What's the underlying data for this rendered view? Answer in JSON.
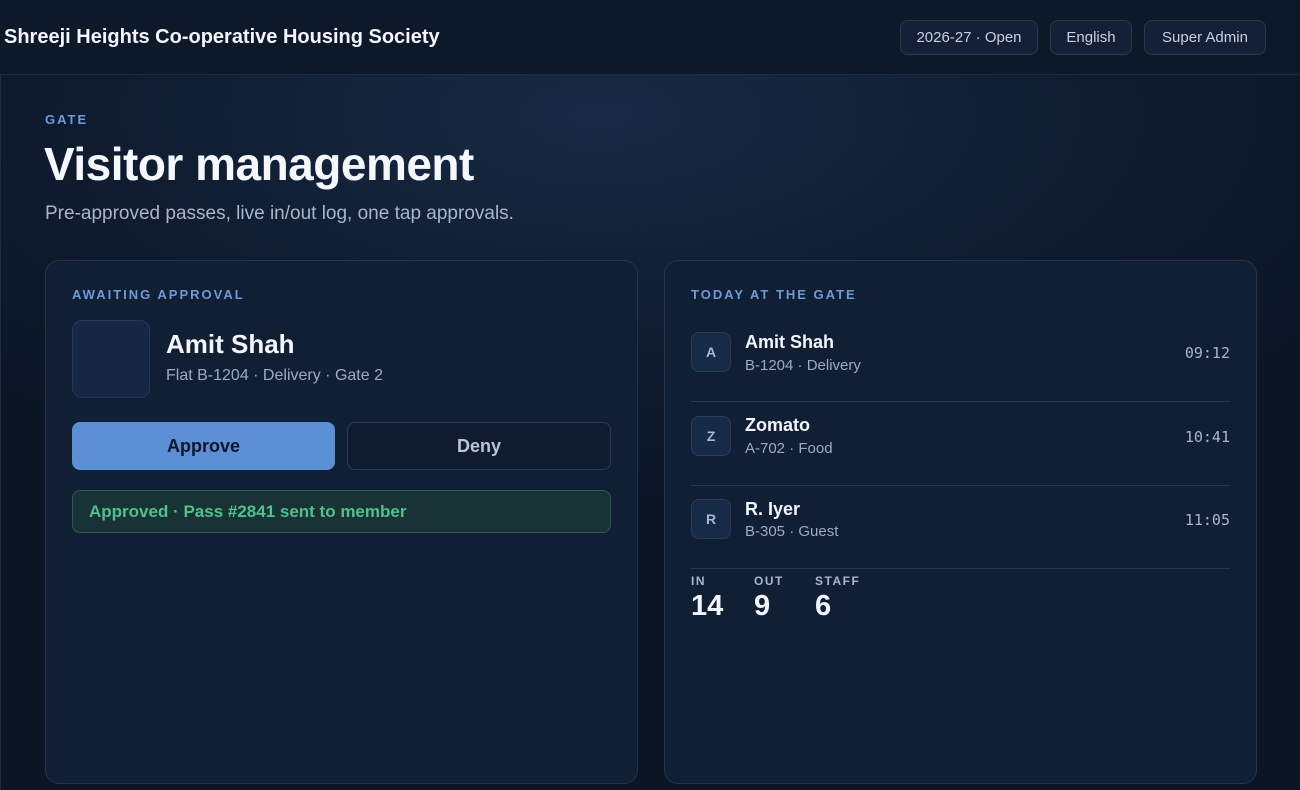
{
  "header": {
    "society_name": "Shreeji Heights Co-operative Housing Society",
    "year_badge": "2026-27 · Open",
    "language": "English",
    "role": "Super Admin"
  },
  "page": {
    "eyebrow": "GATE",
    "title": "Visitor management",
    "subtitle": "Pre-approved passes, live in/out log, one tap approvals."
  },
  "approval": {
    "label": "AWAITING APPROVAL",
    "visitor_name": "Amit Shah",
    "visitor_meta": "Flat B-1204 · Delivery · Gate 2",
    "approve_label": "Approve",
    "deny_label": "Deny",
    "notice": "Approved · Pass #2841 sent to member"
  },
  "today": {
    "label": "TODAY AT THE GATE",
    "entries": [
      {
        "initial": "A",
        "name": "Amit Shah",
        "meta": "B-1204 · Delivery",
        "time": "09:12"
      },
      {
        "initial": "Z",
        "name": "Zomato",
        "meta": "A-702 · Food",
        "time": "10:41"
      },
      {
        "initial": "R",
        "name": "R. Iyer",
        "meta": "B-305 · Guest",
        "time": "11:05"
      }
    ],
    "stats": [
      {
        "label": "IN",
        "value": "14"
      },
      {
        "label": "OUT",
        "value": "9"
      },
      {
        "label": "STAFF",
        "value": "6"
      }
    ]
  },
  "colors": {
    "accent": "#5b8fd6",
    "success": "#52c08a",
    "background": "#0c1626"
  }
}
